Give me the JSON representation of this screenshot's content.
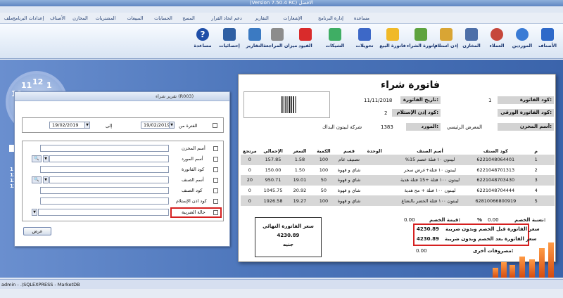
{
  "window": {
    "title": "(Version 7.50.4 RC) الافضل"
  },
  "menu": {
    "items": [
      "ملف",
      "إعدادات البرنامج",
      "الأصناف",
      "المخازن",
      "المشتريات",
      "المبيعات",
      "الحسابات",
      "المسح",
      "دعم اتخاذ القرار",
      "التقارير",
      "الإشعارات",
      "إدارة البرنامج",
      "مساعدة"
    ]
  },
  "toolbar": {
    "items": [
      "الأصناف",
      "الموردين",
      "العملاء",
      "المخازن",
      "إذن استلام",
      "فاتورة الشراء",
      "فاتورة البيع",
      "تحويلات",
      "الشيكات",
      "القيود",
      "ميزان المراجعة",
      "التقارير",
      "إحصائيات",
      "مساعدة"
    ]
  },
  "clock": {
    "numbers": [
      "12",
      "11",
      "1",
      "10"
    ]
  },
  "side": {
    "numbers": [
      "1",
      "12",
      "12",
      "12"
    ]
  },
  "report_window": {
    "title": "تقرير شراء (R003)",
    "period_label": "الفترة من",
    "to_label": "إلى",
    "date_from": "19/02/2019",
    "date_to": "19/02/2019",
    "filters": [
      "أسم المخزن",
      "أسم المورد",
      "كود الفاتورة",
      "أسم الصنف",
      "كود الصنف",
      "كود اذن الإستلام",
      "حالة الضريبة"
    ],
    "show_button": "عرض"
  },
  "invoice": {
    "title": "فاتورة شراء",
    "invoice_code_label": "كود الفاتورة:",
    "invoice_code": "1",
    "invoice_date_label": "تاريخ الفاتورة:",
    "invoice_date": "11/11/2018",
    "paper_code_label": "كود الفاتورة الورقي:",
    "receipt_code_label": "كود إذن الإستلام:",
    "receipt_code": "2",
    "store_label": "أسم المخزن:",
    "store": "المعرض الرئيسي",
    "supplier_label": "المورد:",
    "supplier_code": "1383",
    "supplier_name": "شركة لبيتون البداك",
    "columns": [
      "م",
      "كود الصنف",
      "أسم الصنف",
      "الوحدة",
      "قسم",
      "الكمية",
      "السعر",
      "الإجمالي",
      "مرتجع"
    ],
    "rows": [
      [
        "1",
        "6221048064401",
        "%ليبتون ١٠ فتلة خصم 15",
        "",
        "تصنيف عام",
        "100",
        "1.58",
        "157.85",
        "0"
      ],
      [
        "2",
        "6221048701313",
        "ليبتون ١٠ فتلة+عرض سحر",
        "",
        "شاي و قهوة",
        "100",
        "1.50",
        "150.00",
        "0"
      ],
      [
        "3",
        "6221048703430",
        "ليبتون ١٠٠ فتلة +15 فتلة هدية",
        "",
        "شاي و قهوة",
        "50",
        "19.01",
        "950.71",
        "20"
      ],
      [
        "4",
        "6221048704444",
        "ليبتون ١٠٠ فتلة + مج هدية",
        "",
        "شاي و قهوة",
        "50",
        "20.92",
        "1045.75",
        "0"
      ],
      [
        "5",
        "62810066800919",
        "ليبتون ١٠٠ فتلة الخضر بالنعناع",
        "",
        "شاي و قهوة",
        "100",
        "19.27",
        "1926.58",
        "0"
      ]
    ],
    "discount_pct_label": "نسبة الخصم:",
    "discount_pct": "0.00",
    "pct_sign": "%",
    "discount_value_label": "قيمة الخصم:",
    "discount_value": "0.00",
    "total_box_label": "سعر الفاتورة النهائي",
    "total_box_value": "4230.89",
    "total_box_currency": "جنيه",
    "before_tax_label": "سعر الفاتورة قبل الخصم وبدون ضريبة",
    "before_tax": "4230.89",
    "after_tax_label": "سعر الفاتورة بعد الخصم وبدون ضريبة",
    "after_tax": "4230.89",
    "other_label": "مصروفات أخرى:",
    "other": "0.00"
  },
  "status": {
    "text": "admin - .\\SQLEXPRESS - MarketDB"
  }
}
